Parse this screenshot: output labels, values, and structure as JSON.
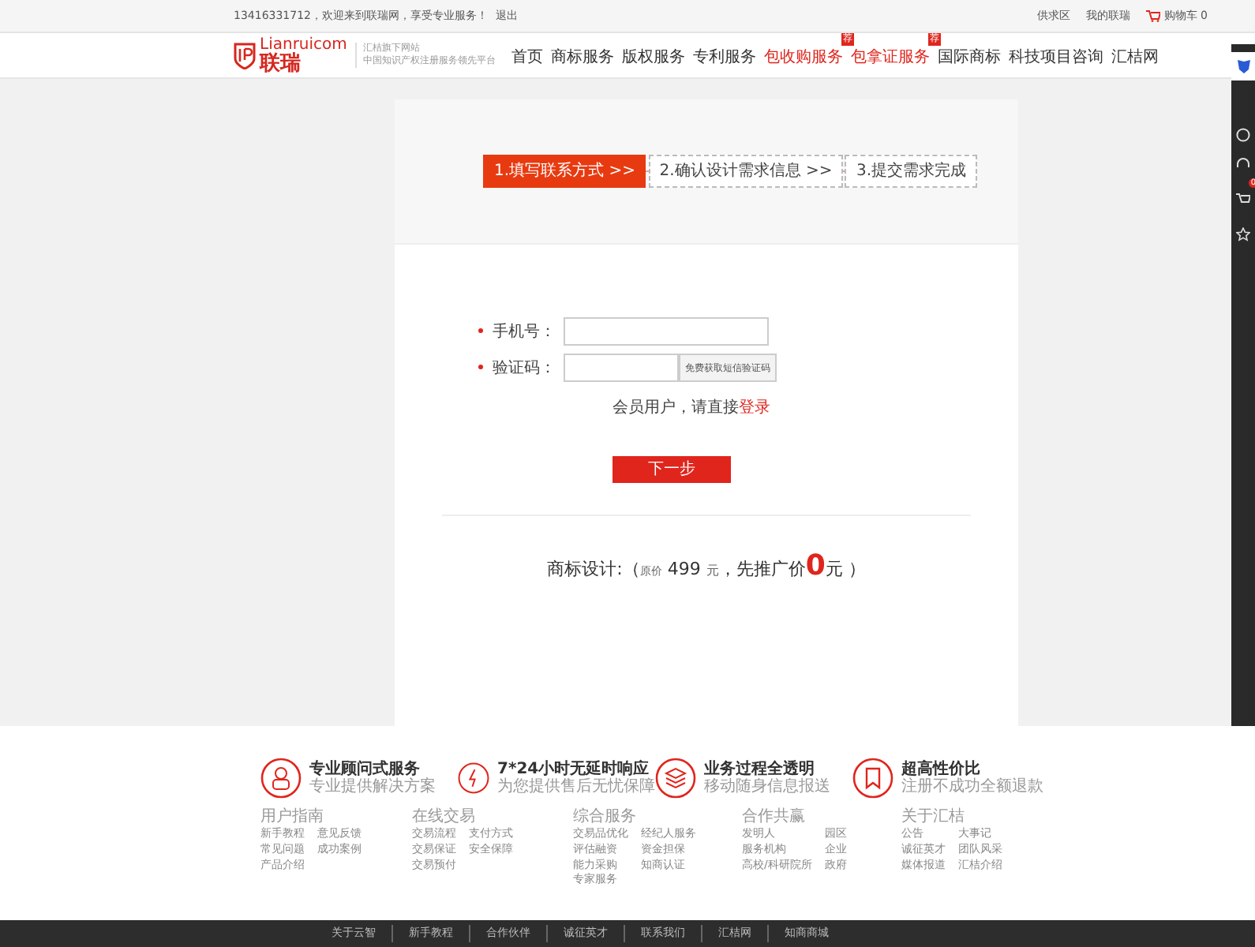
{
  "top_bar": {
    "welcome": "13416331712，欢迎来到联瑞网，享受专业服务！",
    "logout": "退出",
    "links": [
      "供求区",
      "我的联瑞"
    ],
    "cart": {
      "label": "购物车",
      "count": "0"
    }
  },
  "header": {
    "logo": {
      "latin": "Lianruicom",
      "chinese": "联瑞"
    },
    "tagline": [
      "汇桔旗下网站",
      "中国知识产权注册服务领先平台"
    ],
    "nav": [
      {
        "label": "首页",
        "highlight": false
      },
      {
        "label": "商标服务",
        "highlight": false
      },
      {
        "label": "版权服务",
        "highlight": false
      },
      {
        "label": "专利服务",
        "highlight": false
      },
      {
        "label": "包收购服务",
        "highlight": true,
        "badge": "荐"
      },
      {
        "label": "包拿证服务",
        "highlight": true,
        "badge": "荐"
      },
      {
        "label": "国际商标",
        "highlight": false
      },
      {
        "label": "科技项目咨询",
        "highlight": false
      },
      {
        "label": "汇桔网",
        "highlight": false
      }
    ]
  },
  "steps": [
    {
      "label": "1.填写联系方式 >>",
      "selected": true
    },
    {
      "label": "2.确认设计需求信息 >>",
      "selected": false
    },
    {
      "label": "3.提交需求完成",
      "selected": false
    }
  ],
  "form": {
    "fields": [
      {
        "label": "手机号：",
        "required": true,
        "kind": "text"
      },
      {
        "label": "验证码：",
        "required": true,
        "kind": "code",
        "button": "免费获取短信验证码"
      }
    ],
    "member_note": {
      "text": "会员用户，请直接",
      "link": "登录"
    },
    "submit": "下一步"
  },
  "price": {
    "label": "商标设计:（",
    "original_label": "原价",
    "original": "499",
    "unit": "元",
    "separator": "，先推广价",
    "promo": "0",
    "promo_unit": "元",
    "close": "）"
  },
  "features": [
    {
      "title": "专业顾问式服务",
      "subtitle": "专业提供解决方案"
    },
    {
      "title": "7*24小时无延时响应",
      "subtitle": "为您提供售后无忧保障"
    },
    {
      "title": "业务过程全透明",
      "subtitle": "移动随身信息报送"
    },
    {
      "title": "超高性价比",
      "subtitle": "注册不成功全额退款"
    }
  ],
  "footer_columns": [
    {
      "title": "用户指南",
      "links": [
        "新手教程",
        "意见反馈",
        "常见问题",
        "成功案例",
        "产品介绍"
      ]
    },
    {
      "title": "在线交易",
      "links": [
        "交易流程",
        "支付方式",
        "交易保证",
        "安全保障",
        "交易预付"
      ]
    },
    {
      "title": "综合服务",
      "links": [
        "交易品优化",
        "经纪人服务",
        "评估融资",
        "资金担保",
        "能力采购",
        "知商认证",
        "专家服务"
      ]
    },
    {
      "title": "合作共赢",
      "links": [
        "发明人",
        "园区",
        "服务机构",
        "企业",
        "高校/科研院所",
        "政府"
      ]
    },
    {
      "title": "关于汇桔",
      "links": [
        "公告",
        "大事记",
        "诚征英才",
        "团队风采",
        "媒体报道",
        "汇桔介绍"
      ]
    }
  ],
  "bottom_links": [
    "关于云智",
    "新手教程",
    "合作伙伴",
    "诚征英才",
    "联系我们",
    "汇桔网",
    "知商商城"
  ],
  "side_toolbar": {
    "cart_count": "0"
  }
}
